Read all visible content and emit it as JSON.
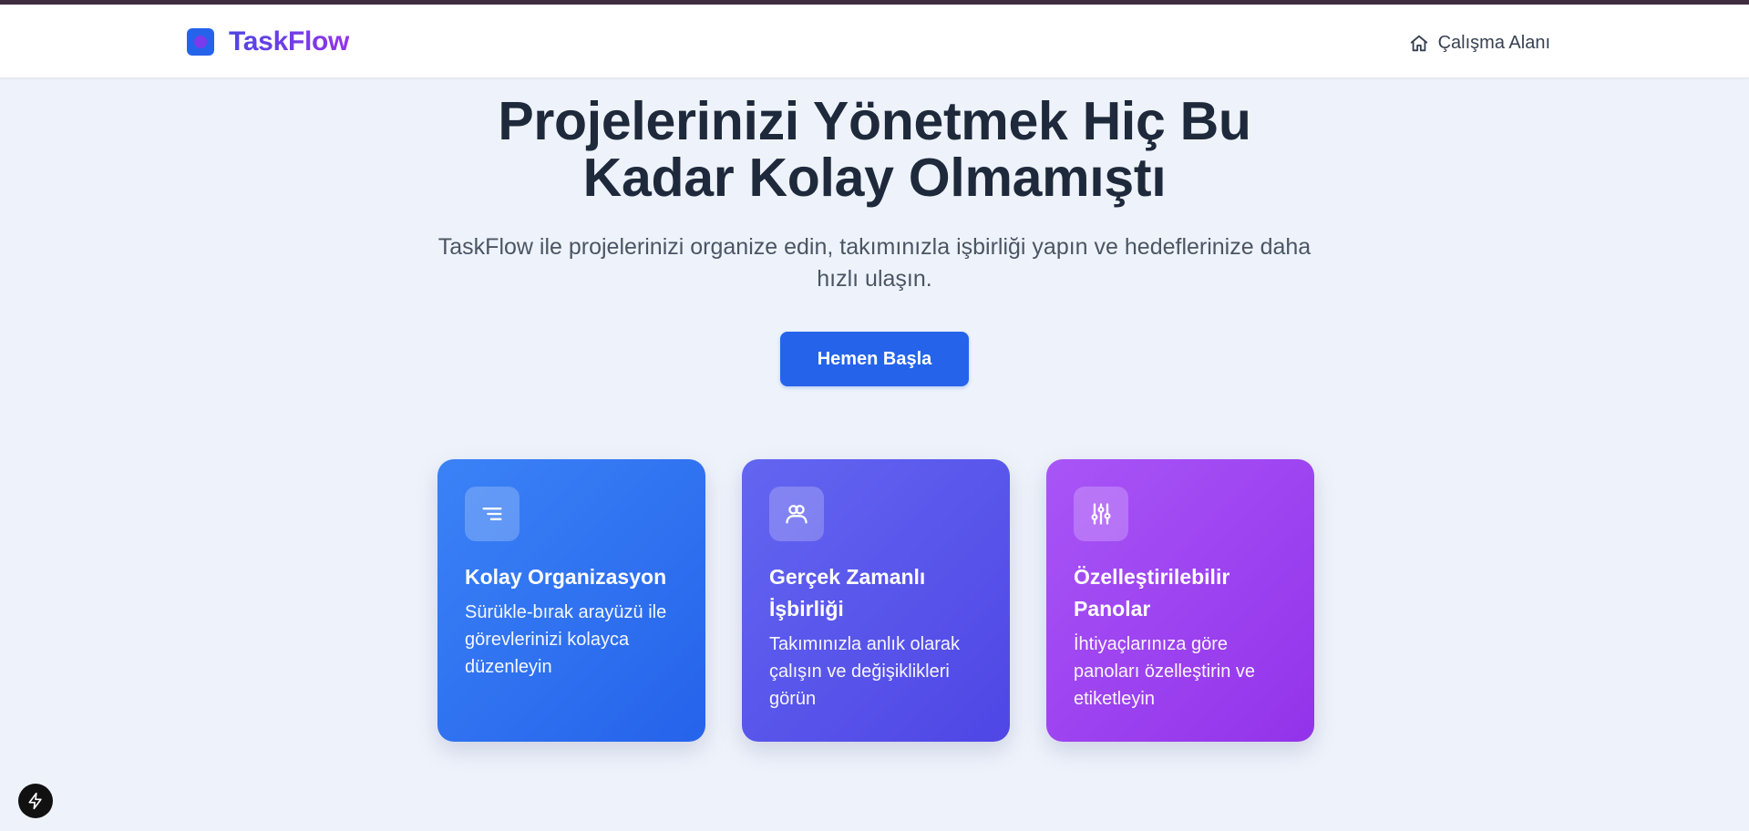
{
  "header": {
    "brand_name": "TaskFlow",
    "nav_link": "Çalışma Alanı"
  },
  "hero": {
    "title_line1": "Projelerinizi Yönetmek Hiç Bu",
    "title_line2": "Kadar Kolay Olmamıştı",
    "subtitle": "TaskFlow ile projelerinizi organize edin, takımınızla işbirliği yapın ve hedeflerinize daha hızlı ulaşın.",
    "cta_label": "Hemen Başla"
  },
  "features": [
    {
      "icon": "list-icon",
      "title": "Kolay Organizasyon",
      "description": "Sürükle-bırak arayüzü ile görevlerinizi kolayca düzenleyin"
    },
    {
      "icon": "users-icon",
      "title": "Gerçek Zamanlı İşbirliği",
      "description": "Takımınızla anlık olarak çalışın ve değişiklikleri görün"
    },
    {
      "icon": "sliders-icon",
      "title": "Özelleştirilebilir Panolar",
      "description": "İhtiyaçlarınıza göre panoları özelleştirin ve etiketleyin"
    }
  ],
  "colors": {
    "primary": "#2563eb",
    "card1": "#3b82f6",
    "card2": "#6366f1",
    "card3": "#a855f7"
  }
}
